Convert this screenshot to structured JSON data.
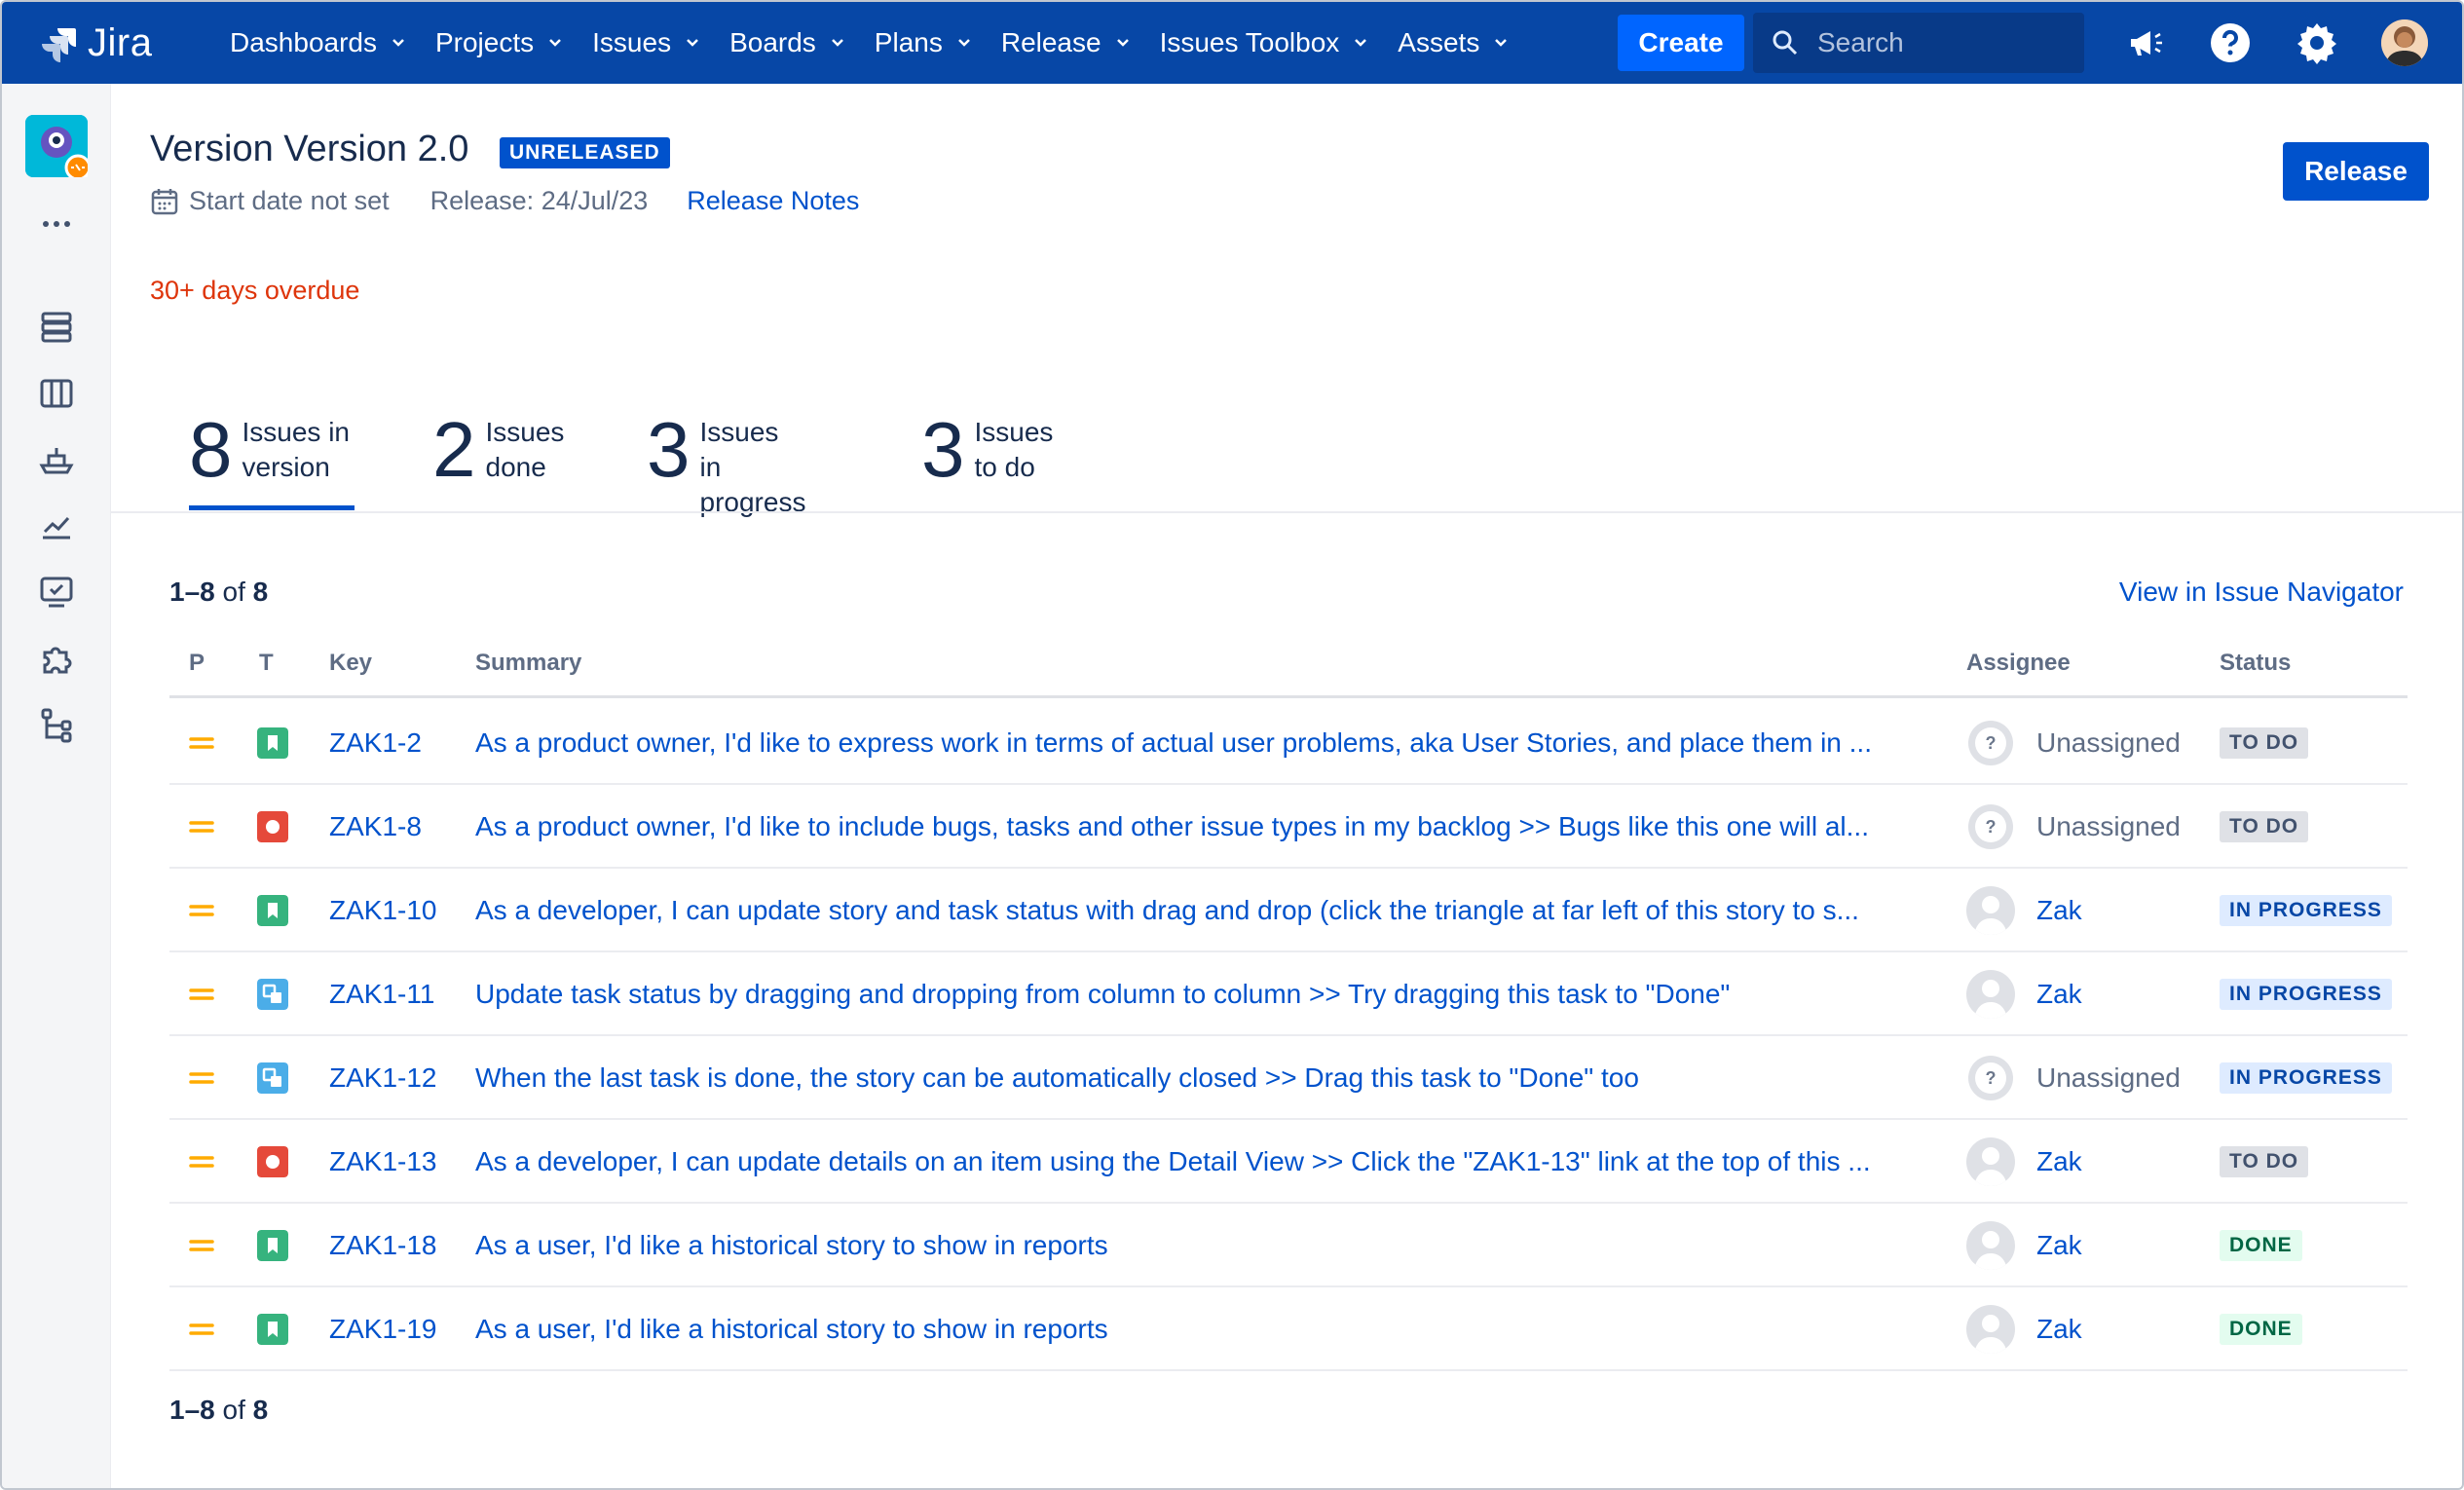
{
  "topnav": {
    "logo_text": "Jira",
    "items": [
      {
        "label": "Dashboards"
      },
      {
        "label": "Projects"
      },
      {
        "label": "Issues"
      },
      {
        "label": "Boards"
      },
      {
        "label": "Plans"
      },
      {
        "label": "Release"
      },
      {
        "label": "Issues Toolbox"
      },
      {
        "label": "Assets"
      }
    ],
    "create_label": "Create",
    "search_placeholder": "Search",
    "bg_color": "#0747a6",
    "create_color": "#0065ff"
  },
  "header": {
    "title": "Version Version 2.0",
    "badge": "UNRELEASED",
    "start_date": "Start date not set",
    "release_date": "Release: 24/Jul/23",
    "release_notes": "Release Notes",
    "release_button": "Release",
    "overdue": "30+ days overdue"
  },
  "summary_tabs": [
    {
      "num": "8",
      "line1": "Issues in",
      "line2": "version"
    },
    {
      "num": "2",
      "line1": "Issues",
      "line2": "done"
    },
    {
      "num": "3",
      "line1": "Issues",
      "line2": "in progress"
    },
    {
      "num": "3",
      "line1": "Issues",
      "line2": "to do"
    }
  ],
  "table": {
    "count_range": "1–8",
    "count_of": "of",
    "count_total": "8",
    "view_in_navigator": "View in Issue Navigator",
    "headers": {
      "p": "P",
      "t": "T",
      "key": "Key",
      "summary": "Summary",
      "assignee": "Assignee",
      "status": "Status"
    },
    "rows": [
      {
        "priority": "medium-priority-icon",
        "type": "story-icon",
        "key": "ZAK1-2",
        "summary": "As a product owner, I'd like to express work in terms of actual user problems, aka User Stories, and place them in ...",
        "assignee": "Unassigned",
        "status": "TO DO"
      },
      {
        "priority": "medium-priority-icon",
        "type": "bug-icon",
        "key": "ZAK1-8",
        "summary": "As a product owner, I'd like to include bugs, tasks and other issue types in my backlog >> Bugs like this one will al...",
        "assignee": "Unassigned",
        "status": "TO DO"
      },
      {
        "priority": "medium-priority-icon",
        "type": "story-icon",
        "key": "ZAK1-10",
        "summary": "As a developer, I can update story and task status with drag and drop (click the triangle at far left of this story to s...",
        "assignee": "Zak",
        "status": "IN PROGRESS"
      },
      {
        "priority": "medium-priority-icon",
        "type": "subtask-icon",
        "key": "ZAK1-11",
        "summary": "Update task status by dragging and dropping from column to column >> Try dragging this task to \"Done\"",
        "assignee": "Zak",
        "status": "IN PROGRESS"
      },
      {
        "priority": "medium-priority-icon",
        "type": "subtask-icon",
        "key": "ZAK1-12",
        "summary": "When the last task is done, the story can be automatically closed >> Drag this task to \"Done\" too",
        "assignee": "Unassigned",
        "status": "IN PROGRESS"
      },
      {
        "priority": "medium-priority-icon",
        "type": "bug-icon",
        "key": "ZAK1-13",
        "summary": "As a developer, I can update details on an item using the Detail View >> Click the \"ZAK1-13\" link at the top of this ...",
        "assignee": "Zak",
        "status": "TO DO"
      },
      {
        "priority": "medium-priority-icon",
        "type": "story-icon",
        "key": "ZAK1-18",
        "summary": "As a user, I'd like a historical story to show in reports",
        "assignee": "Zak",
        "status": "DONE"
      },
      {
        "priority": "medium-priority-icon",
        "type": "story-icon",
        "key": "ZAK1-19",
        "summary": "As a user, I'd like a historical story to show in reports",
        "assignee": "Zak",
        "status": "DONE"
      }
    ]
  },
  "colors": {
    "link": "#0052cc",
    "overdue": "#de350b",
    "story": "#36b37e",
    "bug": "#e5493a",
    "subtask": "#4bade8",
    "medium_priority": "#ffab00"
  }
}
